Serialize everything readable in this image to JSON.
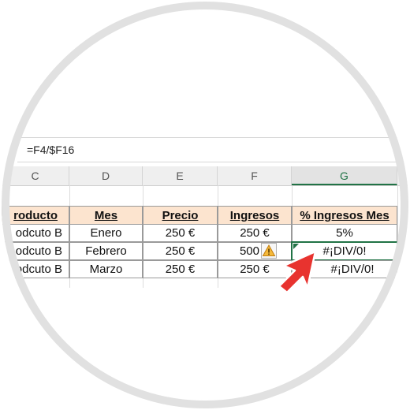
{
  "formula_bar": {
    "formula": "=F4/$F16"
  },
  "columns": [
    {
      "letter": "C"
    },
    {
      "letter": "D"
    },
    {
      "letter": "E"
    },
    {
      "letter": "F"
    },
    {
      "letter": "G"
    }
  ],
  "table": {
    "headers": [
      "roducto",
      "Mes",
      "Precio",
      "Ingresos",
      "% Ingresos Mes"
    ],
    "rows": [
      [
        "odcuto B",
        "Enero",
        "250 €",
        "250 €",
        "5%"
      ],
      [
        "odcuto B",
        "Febrero",
        "250 €",
        "500",
        "#¡DIV/0!"
      ],
      [
        "odcuto B",
        "Marzo",
        "250 €",
        "250 €",
        "#¡DIV/0!"
      ]
    ]
  },
  "icons": {
    "warning": "warning-triangle-icon",
    "pointer": "red-arrow-icon"
  },
  "colors": {
    "header_fill": "#fce4cf",
    "excel_green": "#217346",
    "arrow_red": "#e8332f"
  }
}
